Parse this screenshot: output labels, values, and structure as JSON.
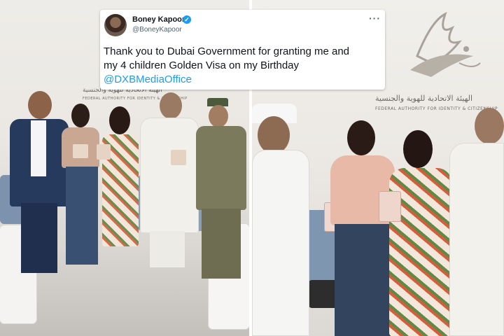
{
  "tweet": {
    "name": "Boney Kapoor",
    "handle": "@BoneyKapoor",
    "verified_icon": "verified-badge-icon",
    "more_label": "···",
    "text_line1": "Thank you to Dubai Government for granting me and",
    "text_line2": "my 4 children Golden Visa on my Birthday",
    "mention": "@DXBMediaOffice",
    "accent_color": "#1d9bf0"
  },
  "photo_left": {
    "wall_arabic": "الهيئة الاتحادية للهوية والجنسية",
    "wall_english": "FEDERAL AUTHORITY FOR IDENTITY & CITIZENSHIP"
  },
  "photo_right": {
    "wall_arabic": "الهيئة الاتحادية للهوية والجنسية",
    "wall_english": "FEDERAL AUTHORITY FOR IDENTITY & CITIZENSHIP"
  }
}
